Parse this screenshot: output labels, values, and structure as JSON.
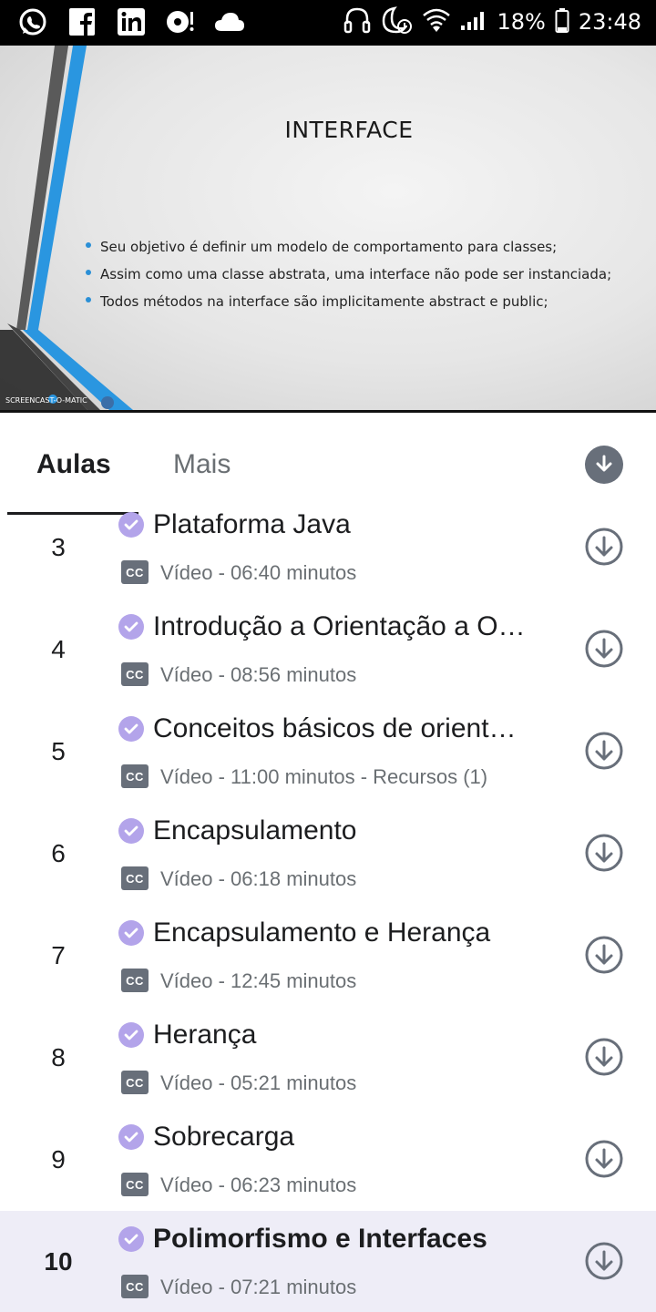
{
  "status_bar": {
    "left_icons": [
      "whatsapp-icon",
      "facebook-icon",
      "linkedin-icon",
      "music-record-icon",
      "cloud-icon"
    ],
    "right_icons": [
      "headphones-icon",
      "do-not-disturb-alarm-icon",
      "wifi-icon",
      "signal-icon"
    ],
    "battery": "18%",
    "time": "23:48"
  },
  "video": {
    "slide_title": "INTERFACE",
    "bullets": [
      "Seu objetivo é definir um modelo de comportamento para classes;",
      "Assim como uma classe abstrata, uma interface não pode ser instanciada;",
      "Todos métodos na interface são implicitamente abstract e public;"
    ],
    "watermark": "SCREENCAST-O-MATIC"
  },
  "tabs": [
    {
      "label": "Aulas",
      "active": true
    },
    {
      "label": "Mais",
      "active": false
    }
  ],
  "lessons": [
    {
      "number": "3",
      "title": "Plataforma Java",
      "meta": "Vídeo - 06:40 minutos",
      "cc": "CC",
      "completed": true,
      "current": false
    },
    {
      "number": "4",
      "title": "Introdução a Orientação a O…",
      "meta": "Vídeo - 08:56 minutos",
      "cc": "CC",
      "completed": true,
      "current": false
    },
    {
      "number": "5",
      "title": "Conceitos básicos de orient…",
      "meta": "Vídeo - 11:00 minutos - Recursos (1)",
      "cc": "CC",
      "completed": true,
      "current": false
    },
    {
      "number": "6",
      "title": "Encapsulamento",
      "meta": "Vídeo - 06:18 minutos",
      "cc": "CC",
      "completed": true,
      "current": false
    },
    {
      "number": "7",
      "title": "Encapsulamento e Herança",
      "meta": "Vídeo - 12:45 minutos",
      "cc": "CC",
      "completed": true,
      "current": false
    },
    {
      "number": "8",
      "title": "Herança",
      "meta": "Vídeo - 05:21 minutos",
      "cc": "CC",
      "completed": true,
      "current": false
    },
    {
      "number": "9",
      "title": "Sobrecarga",
      "meta": "Vídeo - 06:23 minutos",
      "cc": "CC",
      "completed": true,
      "current": false
    },
    {
      "number": "10",
      "title": "Polimorfismo e Interfaces",
      "meta": "Vídeo - 07:21 minutos",
      "cc": "CC",
      "completed": true,
      "current": true
    }
  ],
  "colors": {
    "status_bar": "#000000",
    "check_purple": "#b3a4ea",
    "current_row": "#eeedf7",
    "icon_gray": "#686f7a",
    "text_dark": "#1c1d1f",
    "text_gray": "#6a6f73",
    "slide_blue": "#2a8fd6"
  }
}
